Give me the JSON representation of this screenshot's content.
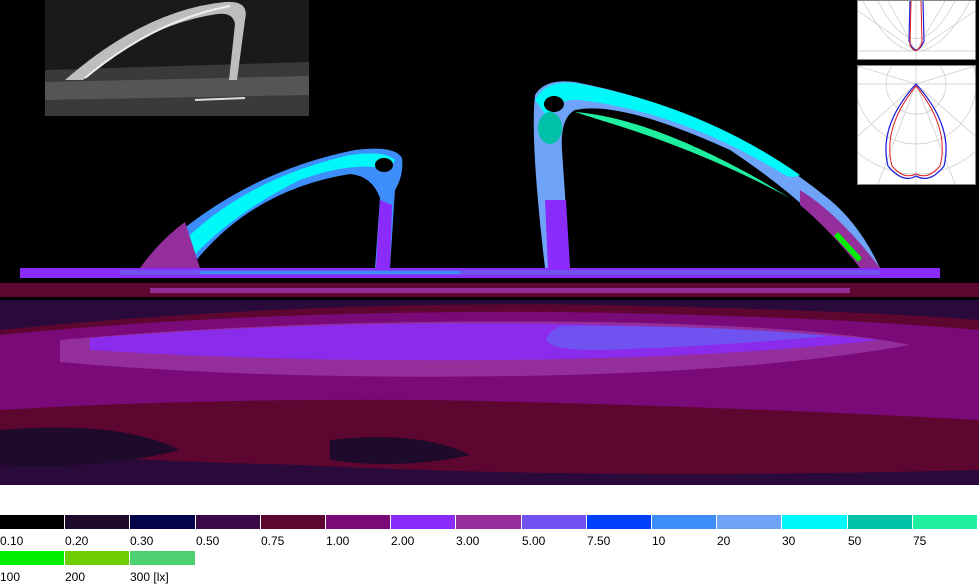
{
  "legend": {
    "colors": [
      "#000000",
      "#1e0a2a",
      "#04044a",
      "#3a0a46",
      "#5c0630",
      "#7a0a78",
      "#8a2bfa",
      "#932e9a",
      "#6f52f0",
      "#0040fa",
      "#3d8efa",
      "#6ea3f8",
      "#00f8f8",
      "#00c0a8",
      "#1ef0a0",
      "#00ee00",
      "#6ecc00",
      "#4cd070"
    ],
    "labels": [
      "0.10",
      "0.20",
      "0.30",
      "0.50",
      "0.75",
      "1.00",
      "2.00",
      "3.00",
      "5.00",
      "7.50",
      "10",
      "20",
      "30",
      "50",
      "75",
      "100",
      "200",
      "300 [lx]"
    ]
  }
}
